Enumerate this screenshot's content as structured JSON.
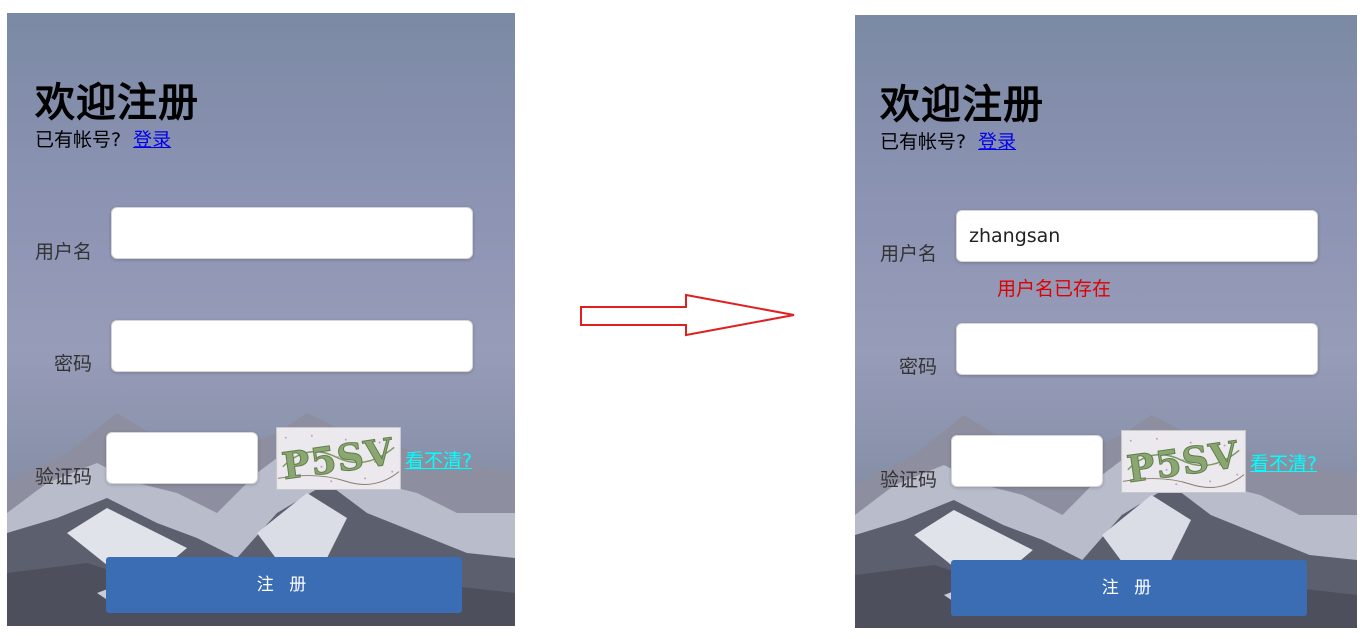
{
  "left_form": {
    "title": "欢迎注册",
    "have_account_text": "已有帐号?",
    "login_link": "登录",
    "username_label": "用户名",
    "username_value": "",
    "password_label": "密码",
    "password_value": "",
    "captcha_label": "验证码",
    "captcha_value": "",
    "captcha_text": "P5SV",
    "refresh_link": "看不清?",
    "submit_label": "注 册"
  },
  "right_form": {
    "title": "欢迎注册",
    "have_account_text": "已有帐号?",
    "login_link": "登录",
    "username_label": "用户名",
    "username_value": "zhangsan",
    "username_error": "用户名已存在",
    "password_label": "密码",
    "password_value": "",
    "captcha_label": "验证码",
    "captcha_value": "",
    "captcha_text": "P5SV",
    "refresh_link": "看不清?",
    "submit_label": "注 册"
  },
  "colors": {
    "arrow": "#e02020",
    "link": "#0000ee",
    "refresh_link": "#00ffff",
    "error": "#e00000",
    "button": "#3b6db4"
  },
  "icons": {
    "arrow": "right-arrow-icon"
  }
}
